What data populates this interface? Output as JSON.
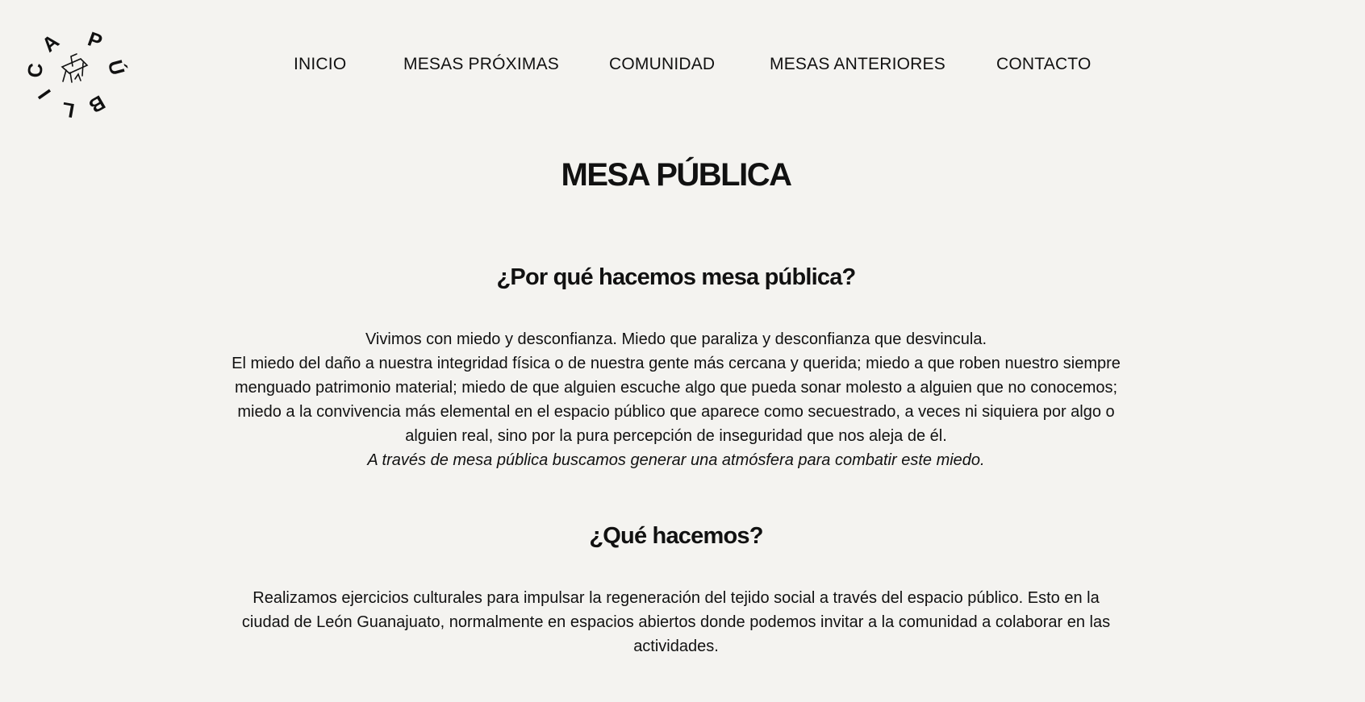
{
  "logo": {
    "letters": [
      "P",
      "Ú",
      "B",
      "L",
      "I",
      "C",
      "A"
    ],
    "alt": "PÚBLICA"
  },
  "nav": {
    "items": [
      {
        "label": "INICIO"
      },
      {
        "label": "MESAS PRÓXIMAS"
      },
      {
        "label": "COMUNIDAD"
      },
      {
        "label": "MESAS ANTERIORES"
      },
      {
        "label": "CONTACTO"
      }
    ]
  },
  "main": {
    "title": "MESA PÚBLICA",
    "section1": {
      "heading": "¿Por qué hacemos mesa pública?",
      "line1": "Vivimos con miedo y desconfianza. Miedo que paraliza y desconfianza que desvincula.",
      "line2": "El miedo del daño a nuestra integridad física o de nuestra gente más cercana y querida; miedo a que roben nuestro siempre menguado patrimonio material; miedo de que alguien escuche algo que pueda sonar molesto a alguien que no conocemos; miedo a la convivencia más elemental en el espacio público que aparece como secuestrado, a veces ni siquiera por algo o alguien real, sino por la pura percepción de inseguridad que nos aleja de él.",
      "line3": "A través de mesa pública buscamos generar una atmósfera para combatir este miedo."
    },
    "section2": {
      "heading": "¿Qué hacemos?",
      "body": "Realizamos ejercicios culturales para impulsar la regeneración del tejido social a través del espacio público. Esto en la ciudad de León Guanajuato, normalmente en espacios abiertos donde podemos invitar a la comunidad a colaborar en las actividades."
    }
  }
}
